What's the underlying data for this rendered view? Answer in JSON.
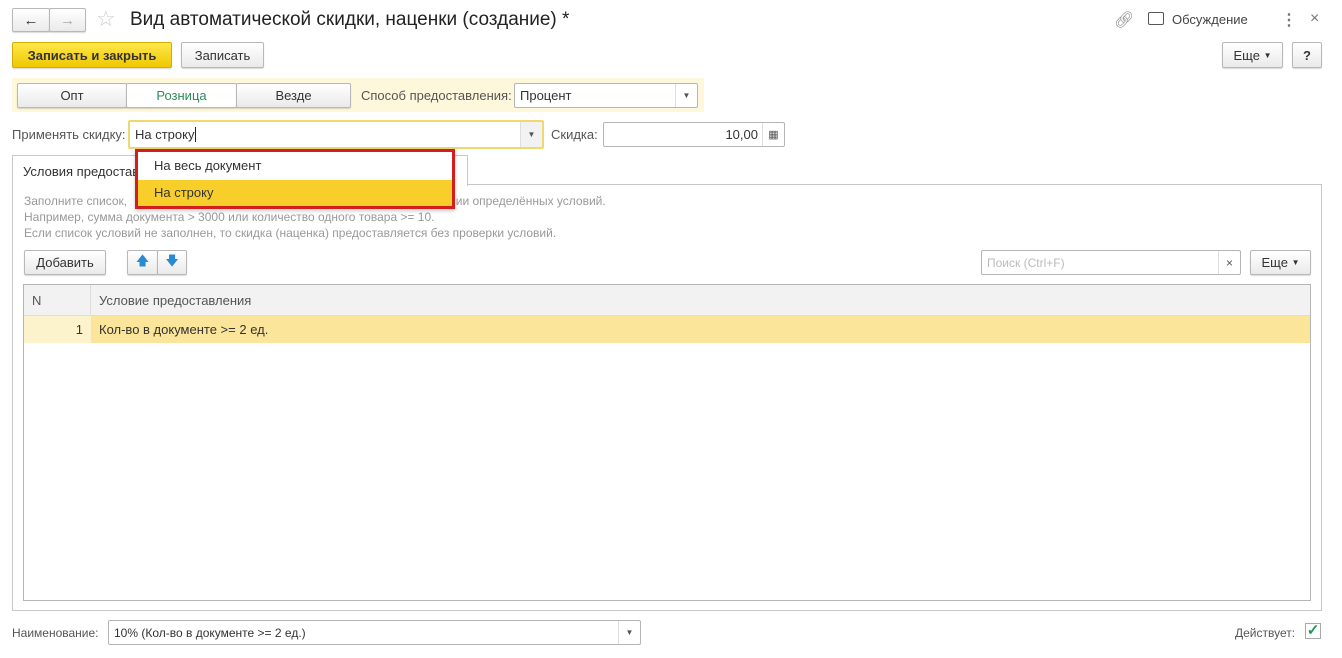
{
  "window": {
    "title": "Вид автоматической скидки, наценки (создание) *",
    "discussion": "Обсуждение"
  },
  "toolbar": {
    "save_close": "Записать и закрыть",
    "save": "Записать",
    "more": "Еще",
    "help": "?"
  },
  "segments": {
    "items": [
      "Опт",
      "Розница",
      "Везде"
    ],
    "active": 1
  },
  "method": {
    "label": "Способ предоставления:",
    "value": "Процент"
  },
  "apply": {
    "label": "Применять скидку:",
    "value": "На строку"
  },
  "discount": {
    "label": "Скидка:",
    "value": "10,00"
  },
  "dropdown": {
    "options": [
      "На весь документ",
      "На строку"
    ],
    "selected": 1
  },
  "tab": {
    "label": "Условия предоставления"
  },
  "hint": {
    "line1_start": "Заполните список,",
    "line1_end": "нии определённых условий.",
    "line2": "Например, сумма документа > 3000 или количество одного товара >= 10.",
    "line3": "Если список условий не заполнен, то скидка (наценка) предоставляется без проверки условий."
  },
  "list_toolbar": {
    "add": "Добавить",
    "search_placeholder": "Поиск (Ctrl+F)",
    "clear": "×",
    "more": "Еще"
  },
  "table": {
    "columns": [
      "N",
      "Условие предоставления"
    ],
    "rows": [
      {
        "n": "1",
        "condition": "Кол-во в документе >= 2 ед."
      }
    ]
  },
  "footer": {
    "name_label": "Наименование:",
    "name_value": "10% (Кол-во в документе >= 2 ед.)",
    "active_label": "Действует:",
    "active": true
  },
  "colors": {
    "accent": "#f5d327",
    "selected_row": "#fbe59a",
    "highlight_border": "#d31e1e",
    "active_segment_text": "#2e8b57"
  }
}
